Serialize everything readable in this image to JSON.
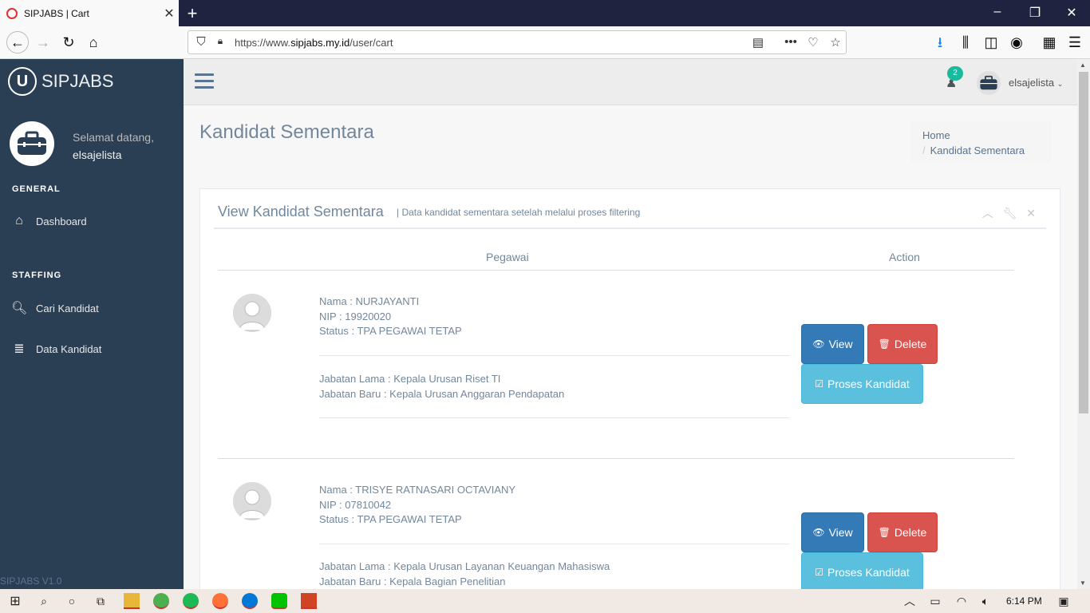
{
  "browser": {
    "tab_title": "SIPJABS | Cart",
    "url_prefix": "https://www.",
    "url_host": "sipjabs.my.id",
    "url_path": "/user/cart"
  },
  "brand": {
    "name": "SIPJABS",
    "logo_letter": "U"
  },
  "profile": {
    "welcome": "Selamat datang,",
    "username": "elsajelista"
  },
  "sidebar": {
    "sections": [
      {
        "title": "GENERAL",
        "items": [
          {
            "label": "Dashboard",
            "icon": "home-icon"
          }
        ]
      },
      {
        "title": "STAFFING",
        "items": [
          {
            "label": "Cari Kandidat",
            "icon": "search-icon"
          },
          {
            "label": "Data Kandidat",
            "icon": "database-icon"
          }
        ]
      }
    ],
    "version": "SIPJABS V1.0"
  },
  "topnav": {
    "notif_count": "2",
    "user": "elsajelista"
  },
  "page": {
    "title": "Kandidat Sementara",
    "breadcrumb": [
      "Home",
      "Kandidat Sementara"
    ]
  },
  "panel": {
    "title": "View Kandidat Sementara",
    "subtitle": "| Data kandidat sementara setelah melalui proses filtering",
    "columns": [
      "Pegawai",
      "Action"
    ]
  },
  "candidates": [
    {
      "nama": "Nama : NURJAYANTI",
      "nip": "NIP : 19920020",
      "status": "Status : TPA PEGAWAI TETAP",
      "jabatan_lama": "Jabatan Lama : Kepala Urusan Riset TI",
      "jabatan_baru": "Jabatan Baru : Kepala Urusan Anggaran Pendapatan"
    },
    {
      "nama": "Nama : TRISYE RATNASARI OCTAVIANY",
      "nip": "NIP : 07810042",
      "status": "Status : TPA PEGAWAI TETAP",
      "jabatan_lama": "Jabatan Lama : Kepala Urusan Layanan Keuangan Mahasiswa",
      "jabatan_baru": "Jabatan Baru : Kepala Bagian Penelitian"
    }
  ],
  "actions": {
    "view": "View",
    "delete": "Delete",
    "process": "Proses Kandidat"
  },
  "taskbar": {
    "time": "6:14 PM"
  },
  "colors": {
    "sidebar": "#2a3f54",
    "primary": "#337ab7",
    "danger": "#d9534f",
    "info": "#5bc0de",
    "badge": "#1abb9c"
  }
}
